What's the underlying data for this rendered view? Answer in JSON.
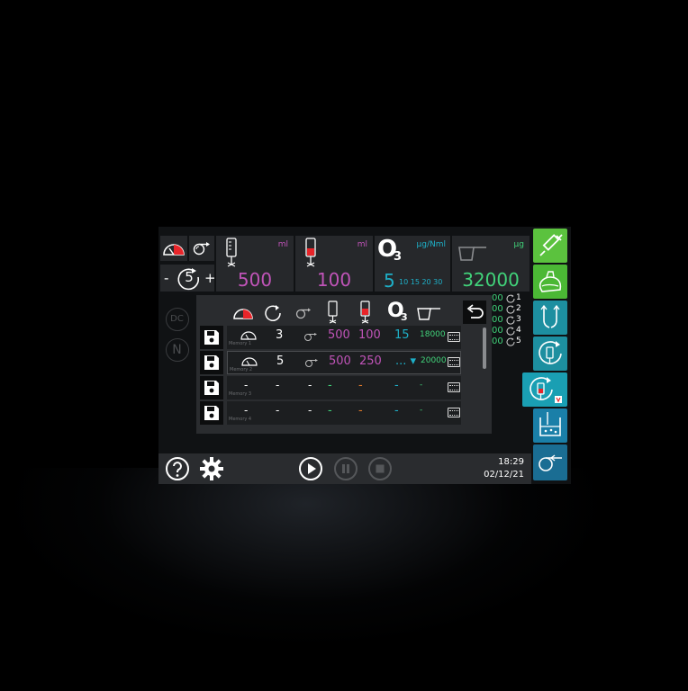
{
  "top": {
    "cycles_value": "5",
    "minus_label": "-",
    "plus_label": "+",
    "vol1": {
      "unit": "ml",
      "value": "500"
    },
    "vol2": {
      "unit": "ml",
      "value": "100"
    },
    "ozone": {
      "symbol": "O",
      "sub": "3",
      "unit": "µg/Nml",
      "value": "5",
      "presets": "10 15 20 30"
    },
    "dose": {
      "unit": "µg",
      "value": "32000"
    }
  },
  "left_marks": {
    "dc": "DC",
    "n": "N"
  },
  "table": {
    "headers": {
      "ozone_symbol": "O",
      "ozone_sub": "3"
    },
    "rows": [
      {
        "cycles": "3",
        "vol1": "500",
        "vol2": "100",
        "conc": "15",
        "dose": "18000",
        "label": "Memory 1"
      },
      {
        "cycles": "5",
        "vol1": "500",
        "vol2": "250",
        "conc": "... ▾",
        "dose": "20000",
        "label": "Memory 2"
      },
      {
        "cycles": "-",
        "col2": "-",
        "vol1": "-",
        "vol2": "-",
        "conc": "-",
        "dose": "-",
        "label": "Memory 3"
      },
      {
        "cycles": "-",
        "col2": "-",
        "vol1": "-",
        "vol2": "-",
        "conc": "-",
        "dose": "-",
        "label": "Memory 4"
      }
    ]
  },
  "counters": [
    {
      "value": "00",
      "index": "1"
    },
    {
      "value": "00",
      "index": "2"
    },
    {
      "value": "00",
      "index": "3"
    },
    {
      "value": "00",
      "index": "4"
    },
    {
      "value": "00",
      "index": "5"
    }
  ],
  "status": {
    "time": "18:29",
    "date": "02/12/21"
  },
  "colors": {
    "magenta": "#c054b8",
    "cyan": "#1eb0c8",
    "green": "#41d37a",
    "red": "#e8252a",
    "side_green": "#5bc23e",
    "side_teal": "#1d8fa0",
    "side_blue": "#1a6d93"
  },
  "icons": {
    "side": [
      "syringe-icon",
      "bag-icon",
      "split-icon",
      "bottle-rotate-icon",
      "bottle-rotate-active-icon",
      "beaker-icon",
      "pump-back-icon"
    ]
  }
}
